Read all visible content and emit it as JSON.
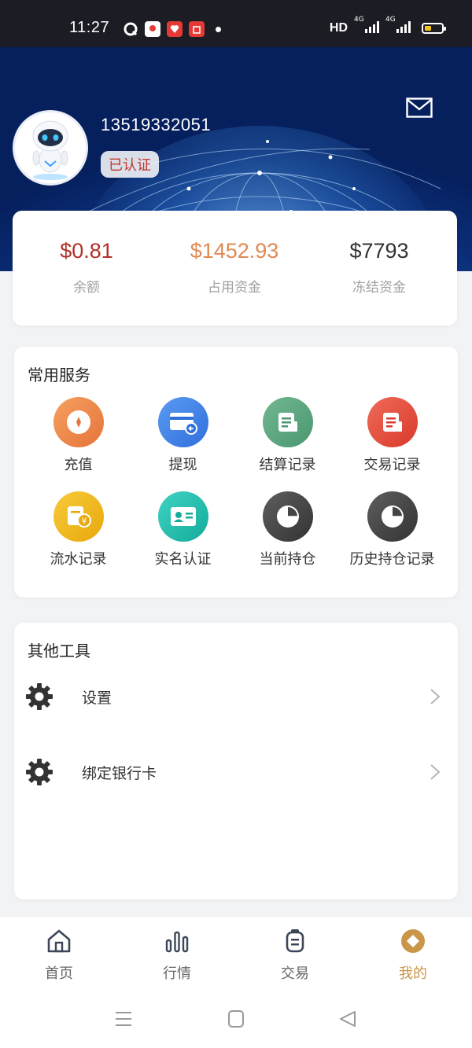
{
  "status_bar": {
    "time": "11:27",
    "network_label": "HD",
    "signal_1": "4G",
    "signal_2": "4G"
  },
  "header": {
    "phone": "13519332051",
    "verified_label": "已认证"
  },
  "balance": {
    "items": [
      {
        "value": "$0.81",
        "label": "余额",
        "color": "#b0302a"
      },
      {
        "value": "$1452.93",
        "label": "占用资金",
        "color": "#e08a52"
      },
      {
        "value": "$7793",
        "label": "冻结资金",
        "color": "#333333"
      }
    ]
  },
  "services": {
    "title": "常用服务",
    "items": [
      {
        "label": "充值",
        "icon": "coin-icon",
        "color": "#ee8a4a"
      },
      {
        "label": "提现",
        "icon": "card-withdraw-icon",
        "color": "#3f7fe8"
      },
      {
        "label": "结算记录",
        "icon": "document-icon",
        "color": "#5aa47c"
      },
      {
        "label": "交易记录",
        "icon": "document-icon",
        "color": "#e44c3c"
      },
      {
        "label": "流水记录",
        "icon": "yen-receipt-icon",
        "color": "#f1b81c"
      },
      {
        "label": "实名认证",
        "icon": "id-card-icon",
        "color": "#1fc1b0"
      },
      {
        "label": "当前持仓",
        "icon": "pie-chart-icon",
        "color": "#4a4a4a"
      },
      {
        "label": "历史持仓记录",
        "icon": "pie-chart-icon",
        "color": "#4a4a4a"
      }
    ]
  },
  "tools": {
    "title": "其他工具",
    "items": [
      {
        "label": "设置",
        "icon": "gear-icon"
      },
      {
        "label": "绑定银行卡",
        "icon": "gear-icon"
      }
    ]
  },
  "bottom_nav": {
    "items": [
      {
        "label": "首页",
        "icon": "home-icon"
      },
      {
        "label": "行情",
        "icon": "bar-chart-icon"
      },
      {
        "label": "交易",
        "icon": "trade-icon"
      },
      {
        "label": "我的",
        "icon": "profile-diamond-icon",
        "active": true
      }
    ],
    "active_color": "#c9964a"
  }
}
